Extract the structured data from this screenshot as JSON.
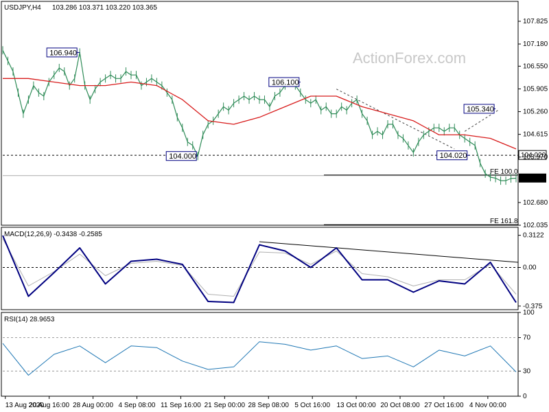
{
  "header": {
    "symbol_timeframe": "USDJPY,H4",
    "ohlc": "103.286 103.371 103.220 103.365"
  },
  "watermark": "ActionForex.com",
  "colors": {
    "price": "#2e8b57",
    "ma": "#d81c1c",
    "macd": "#000080",
    "signal": "#b0b0b0",
    "rsi": "#1f77b4",
    "trend": "#000000",
    "tag_border": "#000080"
  },
  "chart_data": [
    {
      "type": "line",
      "panel": "price",
      "ylim": [
        102.035,
        108.39
      ],
      "yticks": [
        "107.825",
        "107.180",
        "106.550",
        "105.905",
        "105.260",
        "104.615",
        "103.970",
        "102.680",
        "102.035"
      ],
      "xticks": [
        "13 Aug 2020",
        "20 Aug 16:00",
        "28 Aug 00:00",
        "4 Sep 08:00",
        "11 Sep 16:00",
        "21 Sep 00:00",
        "28 Sep 08:00",
        "5 Oct 16:00",
        "13 Oct 00:00",
        "20 Oct 08:00",
        "27 Oct 16:00",
        "4 Nov 00:00"
      ],
      "series": [
        {
          "role": "price",
          "x": [
            0,
            2,
            4,
            6,
            8,
            10,
            12,
            14,
            16,
            18,
            20,
            22,
            24,
            26,
            28,
            30,
            32,
            34,
            36,
            38,
            40,
            42,
            44,
            46,
            48,
            50,
            52,
            54,
            56,
            58,
            60,
            62,
            64,
            66,
            68,
            70,
            72,
            74,
            76,
            78,
            80,
            82,
            84,
            86,
            88,
            90,
            92,
            94,
            96,
            98,
            100,
            102,
            104,
            106,
            108,
            110,
            112,
            114,
            116,
            118,
            120,
            122,
            124,
            126,
            128,
            130,
            132,
            134,
            136,
            138,
            140,
            142,
            144,
            146,
            148,
            150,
            152,
            154,
            156,
            158,
            160,
            162,
            164,
            166,
            168,
            170,
            172,
            174,
            176,
            178,
            180,
            182,
            184,
            186,
            188,
            190,
            192,
            194,
            196,
            198,
            200
          ],
          "values": [
            107.0,
            106.7,
            106.4,
            105.8,
            105.2,
            105.6,
            106.0,
            105.8,
            105.7,
            106.1,
            106.3,
            106.5,
            106.4,
            106.0,
            106.2,
            106.94,
            106.0,
            105.6,
            105.9,
            106.1,
            106.2,
            106.3,
            106.2,
            106.2,
            106.4,
            106.3,
            106.3,
            106.0,
            106.1,
            106.2,
            106.1,
            106.0,
            105.8,
            105.6,
            105.1,
            104.8,
            104.4,
            104.3,
            104.0,
            104.6,
            104.9,
            105.0,
            105.2,
            105.4,
            105.3,
            105.5,
            105.6,
            105.7,
            105.6,
            105.7,
            105.6,
            105.6,
            105.4,
            105.7,
            105.8,
            106.0,
            106.1,
            106.0,
            105.8,
            105.6,
            105.5,
            105.6,
            105.3,
            105.4,
            105.2,
            105.2,
            105.4,
            105.3,
            105.5,
            105.6,
            105.2,
            105.0,
            104.6,
            104.7,
            104.6,
            104.9,
            104.9,
            104.6,
            104.5,
            104.3,
            104.1,
            104.4,
            104.6,
            104.7,
            104.8,
            104.8,
            104.7,
            104.8,
            104.8,
            104.6,
            104.5,
            104.4,
            104.3,
            103.8,
            103.5,
            103.4,
            103.37,
            103.3,
            103.3,
            103.36,
            103.37
          ]
        },
        {
          "role": "moving-average",
          "x": [
            0,
            10,
            20,
            30,
            40,
            50,
            60,
            70,
            80,
            90,
            100,
            110,
            120,
            130,
            140,
            150,
            160,
            170,
            180,
            190,
            200
          ],
          "values": [
            106.2,
            106.2,
            106.1,
            106.0,
            106.0,
            106.1,
            106.0,
            105.6,
            105.0,
            104.9,
            105.1,
            105.4,
            105.7,
            105.7,
            105.4,
            105.2,
            105.0,
            104.6,
            104.6,
            104.5,
            104.2
          ]
        }
      ],
      "annotations": [
        {
          "label": "106.940",
          "x": 30,
          "y": 106.94
        },
        {
          "label": "104.000",
          "x": 76,
          "y": 104.0
        },
        {
          "label": "106.100",
          "x": 116,
          "y": 106.1
        },
        {
          "label": "104.020",
          "x": 182,
          "y": 104.02
        },
        {
          "label": "105.340",
          "x": 192,
          "y": 105.34
        }
      ],
      "levels": [
        {
          "label": "104.020",
          "value": 104.02,
          "style": "dashed"
        },
        {
          "label": "103.365",
          "value": 103.365,
          "style": "solid-highlight"
        },
        {
          "label": "FE 100.0",
          "value": 103.46,
          "style": "solid"
        },
        {
          "label": "FE 161.8",
          "value": 102.05,
          "style": "solid"
        }
      ]
    },
    {
      "type": "line",
      "panel": "macd",
      "title": "MACD(12,26,9) -0.3438 -0.2585",
      "ylim": [
        -0.41,
        0.39
      ],
      "yticks": [
        "0.3122",
        "0.00",
        "-0.375"
      ],
      "series": [
        {
          "role": "macd",
          "x": [
            0,
            10,
            20,
            30,
            40,
            50,
            60,
            70,
            80,
            90,
            100,
            110,
            120,
            130,
            140,
            150,
            160,
            170,
            180,
            190,
            200
          ],
          "values": [
            0.31,
            -0.28,
            -0.05,
            0.19,
            -0.16,
            0.06,
            0.08,
            0.03,
            -0.33,
            -0.34,
            0.22,
            0.16,
            0.0,
            0.19,
            -0.12,
            -0.12,
            -0.24,
            -0.13,
            -0.16,
            0.05,
            -0.34
          ]
        },
        {
          "role": "signal",
          "x": [
            0,
            10,
            20,
            30,
            40,
            50,
            60,
            70,
            80,
            90,
            100,
            110,
            120,
            130,
            140,
            150,
            160,
            170,
            180,
            190,
            200
          ],
          "values": [
            0.28,
            -0.18,
            -0.04,
            0.13,
            -0.08,
            0.04,
            0.06,
            0.02,
            -0.26,
            -0.28,
            0.15,
            0.14,
            0.03,
            0.16,
            -0.06,
            -0.09,
            -0.18,
            -0.12,
            -0.12,
            0.03,
            -0.26
          ]
        }
      ]
    },
    {
      "type": "line",
      "panel": "rsi",
      "title": "RSI(14) 28.9653",
      "ylim": [
        0,
        100
      ],
      "yticks": [
        "100",
        "70",
        "30",
        "0"
      ],
      "series": [
        {
          "role": "rsi",
          "x": [
            0,
            10,
            20,
            30,
            40,
            50,
            60,
            70,
            80,
            90,
            100,
            110,
            120,
            130,
            140,
            150,
            160,
            170,
            180,
            190,
            200
          ],
          "values": [
            63,
            25,
            50,
            60,
            40,
            60,
            58,
            42,
            32,
            35,
            65,
            62,
            55,
            60,
            45,
            48,
            35,
            55,
            48,
            60,
            29
          ]
        }
      ]
    }
  ]
}
